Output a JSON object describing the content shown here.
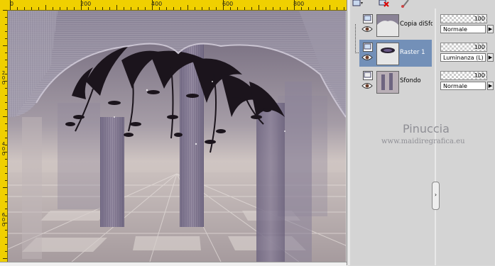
{
  "ruler": {
    "h_labels": [
      "0",
      "200",
      "400",
      "600",
      "800"
    ],
    "v_labels": [
      "2",
      "0",
      "0",
      "4",
      "0",
      "0",
      "6",
      "0",
      "0"
    ]
  },
  "toolbar": {
    "icons": [
      "new-layer-icon",
      "delete-layer-icon",
      "edit-icon"
    ]
  },
  "layers": [
    {
      "name": "Copia diSfondo",
      "opacity": "100",
      "blend": "Normale",
      "selected": false
    },
    {
      "name": "Raster 1",
      "opacity": "100",
      "blend": "Luminanza (L)",
      "selected": true
    },
    {
      "name": "Sfondo",
      "opacity": "100",
      "blend": "Normale",
      "selected": false
    }
  ],
  "watermark": {
    "title": "Pinuccia",
    "url": "www.maidiregrafica.eu"
  },
  "colors": {
    "ruler": "#f0d000",
    "selection": "#7390b8",
    "curtain": "#7d7688",
    "floor": "#b7adaf"
  }
}
